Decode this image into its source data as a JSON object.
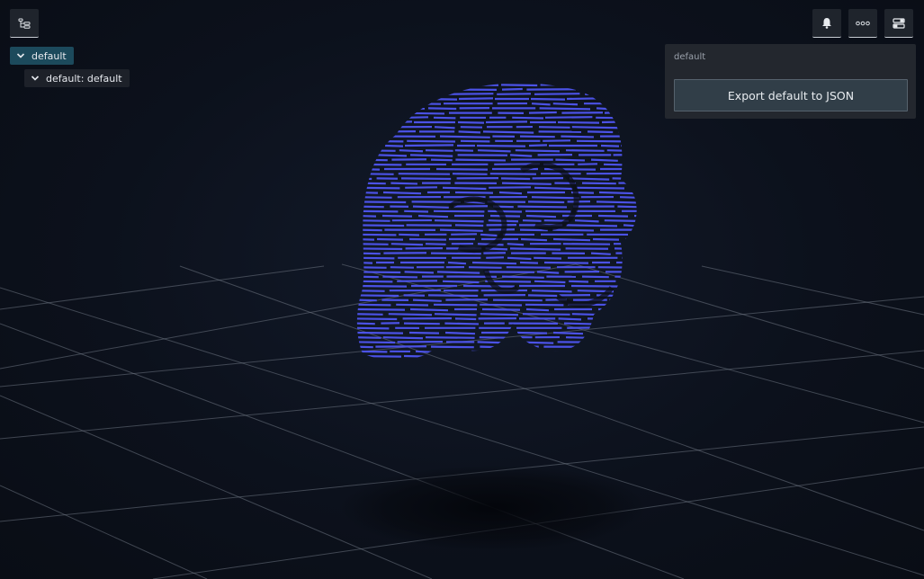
{
  "toolbar": {
    "tree_icon": "tree-icon",
    "bell_icon": "bell-icon",
    "more_icon": "ellipsis-icon",
    "panel_icon": "panel-settings-icon"
  },
  "tree": {
    "root_label": "default",
    "child_label": "default: default"
  },
  "panel": {
    "title": "default",
    "export_label": "Export default to JSON"
  },
  "scene": {
    "object_icon": "skull-point-cloud",
    "object_color": "#4b52e6",
    "grid_color": "#6d7582"
  }
}
